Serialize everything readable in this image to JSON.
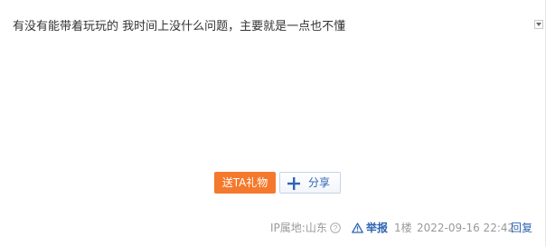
{
  "post": {
    "content": "有没有能带着玩玩的 我时间上没什么问题，主要就是一点也不懂"
  },
  "actions": {
    "gift_label": "送TA礼物",
    "share_label": "分享"
  },
  "tail": {
    "ip_label": "IP属地:山东",
    "report_label": "举报",
    "floor": "1楼",
    "time": "2022-09-16 22:42",
    "reply_label": "回复"
  },
  "colors": {
    "gift_button": "#f5792c",
    "link": "#2d64b3",
    "meta_text": "#999999"
  }
}
